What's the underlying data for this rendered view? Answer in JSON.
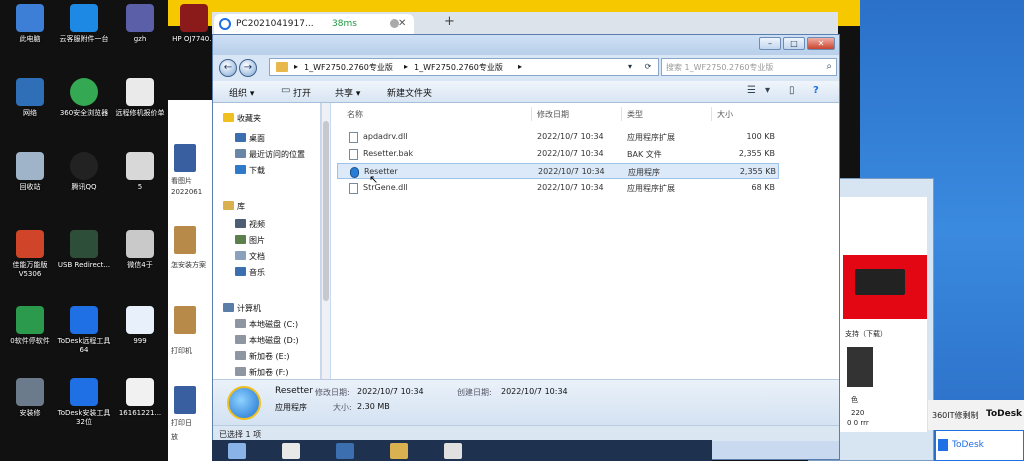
{
  "desktop": {
    "icons": [
      {
        "label": "此电脑"
      },
      {
        "label": "云客服附件一台"
      },
      {
        "label": "gzh"
      },
      {
        "label": "HP OJ7740..."
      },
      {
        "label": "网络"
      },
      {
        "label": "360安全浏览器"
      },
      {
        "label": "远程修机报价单"
      },
      {
        "label": "回收站"
      },
      {
        "label": "腾讯QQ"
      },
      {
        "label": "5"
      },
      {
        "label": "佳能万能版 V5306"
      },
      {
        "label": "USB Redirect..."
      },
      {
        "label": "微信4于"
      },
      {
        "label": "0软件停软件"
      },
      {
        "label": "ToDesk远程工具64"
      },
      {
        "label": "999"
      },
      {
        "label": "安装修"
      },
      {
        "label": "ToDesk安装工具32位"
      },
      {
        "label": "16161221..."
      }
    ]
  },
  "background_window": {
    "labels": [
      "看图片",
      "2022061",
      "怎安装方案",
      "打印机",
      "打印日",
      "放"
    ]
  },
  "right_window": {
    "support_text": "支持（下载）",
    "side_texts": [
      "色",
      "220",
      "0 0 rrr"
    ]
  },
  "todesk": {
    "strip_left": "360IT修剩制",
    "strip_right": "ToDesk",
    "popup_label": "ToDesk"
  },
  "browser_tab": {
    "title": "PC2021041917...",
    "latency": "38ms",
    "close": "✕",
    "new_tab": "+"
  },
  "explorer": {
    "window_controls": {
      "minimize": "–",
      "maximize": "□",
      "close": "✕"
    },
    "nav": {
      "back": "←",
      "forward": "→"
    },
    "breadcrumb": [
      "1_WF2750.2760专业版",
      "1_WF2750.2760专业版"
    ],
    "search_placeholder": "搜索 1_WF2750.2760专业版",
    "toolbar": {
      "organize": "组织 ▾",
      "open": "打开",
      "share": "共享 ▾",
      "new_folder": "新建文件夹"
    },
    "navpane": {
      "favorites": "收藏夹",
      "fav_items": [
        "桌面",
        "最近访问的位置",
        "下载"
      ],
      "library": "库",
      "lib_items": [
        "视频",
        "图片",
        "文档",
        "音乐"
      ],
      "computer": "计算机",
      "drives": [
        "本地磁盘 (C:)",
        "本地磁盘 (D:)",
        "新加卷 (E:)",
        "新加卷 (F:)"
      ]
    },
    "columns": {
      "name": "名称",
      "date": "修改日期",
      "type": "类型",
      "size": "大小"
    },
    "files": [
      {
        "name": "apdadrv.dll",
        "date": "2022/10/7 10:34",
        "type": "应用程序扩展",
        "size": "100 KB",
        "icon": "dll-icon"
      },
      {
        "name": "Resetter.bak",
        "date": "2022/10/7 10:34",
        "type": "BAK 文件",
        "size": "2,355 KB",
        "icon": "file-icon"
      },
      {
        "name": "Resetter",
        "date": "2022/10/7 10:34",
        "type": "应用程序",
        "size": "2,355 KB",
        "icon": "exe-icon",
        "selected": true
      },
      {
        "name": "StrGene.dll",
        "date": "2022/10/7 10:34",
        "type": "应用程序扩展",
        "size": "68 KB",
        "icon": "dll-icon"
      }
    ],
    "details": {
      "name": "Resetter",
      "modified_label": "修改日期:",
      "modified": "2022/10/7 10:34",
      "created_label": "创建日期:",
      "created": "2022/10/7 10:34",
      "kind": "应用程序",
      "size_label": "大小:",
      "size": "2.30 MB"
    },
    "status": "已选择 1 项"
  }
}
